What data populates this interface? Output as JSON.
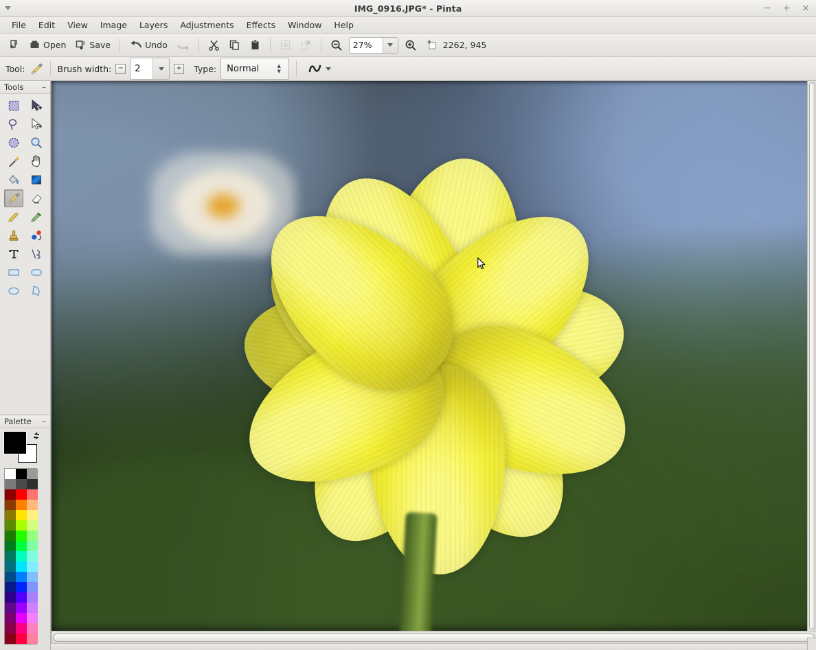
{
  "window": {
    "title": "IMG_0916.JPG* - Pinta",
    "menu_arrow_icon": "chevron-down-icon",
    "controls": [
      {
        "name": "minimize",
        "glyph": "−"
      },
      {
        "name": "maximize",
        "glyph": "+"
      },
      {
        "name": "close",
        "glyph": "×"
      }
    ]
  },
  "menubar": {
    "items": [
      {
        "label": "File"
      },
      {
        "label": "Edit"
      },
      {
        "label": "View"
      },
      {
        "label": "Image"
      },
      {
        "label": "Layers"
      },
      {
        "label": "Adjustments"
      },
      {
        "label": "Effects"
      },
      {
        "label": "Window"
      },
      {
        "label": "Help"
      }
    ]
  },
  "toolbar": {
    "new_label": "",
    "open_label": "Open",
    "save_label": "Save",
    "undo_label": "Undo",
    "redo_label": "",
    "cut_label": "",
    "copy_label": "",
    "paste_label": "",
    "crop_label": "",
    "deselect_label": "",
    "zoom_out_label": "",
    "zoom_in_label": "",
    "zoom_value": "27%",
    "zoom_dropdown_icon": "chevron-down-icon",
    "cursor_position": "2262, 945",
    "icons": {
      "new": "new-image-icon",
      "open": "open-folder-icon",
      "save": "save-disk-icon",
      "undo": "undo-arrow-icon",
      "redo": "redo-arrow-icon",
      "cut": "scissors-icon",
      "copy": "copy-icon",
      "paste": "clipboard-icon",
      "crop": "crop-to-selection-icon",
      "deselect": "deselect-icon",
      "zoom_out": "zoom-out-icon",
      "zoom_in": "zoom-in-icon",
      "position": "cursor-position-icon"
    }
  },
  "tooloptions": {
    "tool_label": "Tool:",
    "tool_icon": "paintbrush-icon",
    "brush_width_label": "Brush width:",
    "brush_width_value": "2",
    "decrease_glyph": "−",
    "increase_glyph": "+",
    "dropdown_icon": "chevron-down-icon",
    "type_label": "Type:",
    "type_value": "Normal",
    "blend_icon": "squiggle-curve-icon",
    "blend_dropdown_icon": "chevron-down-icon"
  },
  "tools_panel": {
    "title": "Tools",
    "minimize_glyph": "–",
    "selected_tool": "paintbrush",
    "tools": [
      {
        "id": "rectangle-select",
        "label": "Rectangle Select"
      },
      {
        "id": "move-selected",
        "label": "Move Selected"
      },
      {
        "id": "lasso-select",
        "label": "Lasso Select"
      },
      {
        "id": "move-selection",
        "label": "Move Selection"
      },
      {
        "id": "ellipse-select",
        "label": "Ellipse Select"
      },
      {
        "id": "zoom",
        "label": "Zoom"
      },
      {
        "id": "magic-wand",
        "label": "Magic Wand Select"
      },
      {
        "id": "pan",
        "label": "Pan"
      },
      {
        "id": "paint-bucket",
        "label": "Paint Bucket"
      },
      {
        "id": "gradient",
        "label": "Gradient"
      },
      {
        "id": "paintbrush",
        "label": "Paintbrush"
      },
      {
        "id": "eraser",
        "label": "Eraser"
      },
      {
        "id": "pencil",
        "label": "Pencil"
      },
      {
        "id": "color-picker",
        "label": "Color Picker"
      },
      {
        "id": "clone-stamp",
        "label": "Clone Stamp"
      },
      {
        "id": "recolor",
        "label": "Recolor"
      },
      {
        "id": "text",
        "label": "Text"
      },
      {
        "id": "line-curve",
        "label": "Line / Curve"
      },
      {
        "id": "rectangle",
        "label": "Rectangle"
      },
      {
        "id": "rounded-rectangle",
        "label": "Rounded Rectangle"
      },
      {
        "id": "ellipse",
        "label": "Ellipse"
      },
      {
        "id": "freeform-shape",
        "label": "Freeform Shape"
      }
    ]
  },
  "palette_panel": {
    "title": "Palette",
    "minimize_glyph": "–",
    "primary_color": "#000000",
    "secondary_color": "#ffffff",
    "swap_icon": "swap-colors-icon",
    "swatches": [
      [
        "#ffffff",
        "#000000",
        "#9a9a9a"
      ],
      [
        "#7b7b7b",
        "#4a4a4a",
        "#303030"
      ],
      [
        "#8a0000",
        "#ff0000",
        "#ff7272"
      ],
      [
        "#8a3a00",
        "#ff7f00",
        "#ffb87a"
      ],
      [
        "#8a7a00",
        "#ffe500",
        "#fff07f"
      ],
      [
        "#5c8a00",
        "#a8ff00",
        "#d3ff7f"
      ],
      [
        "#1f7a00",
        "#22ff00",
        "#95ff7f"
      ],
      [
        "#007a1f",
        "#00ff40",
        "#7fffa3"
      ],
      [
        "#007a5e",
        "#00ffbf",
        "#7fffdf"
      ],
      [
        "#00707f",
        "#00e5ff",
        "#7fefff"
      ],
      [
        "#004c8a",
        "#0080ff",
        "#7fbfff"
      ],
      [
        "#0b1a8a",
        "#0026ff",
        "#8093ff"
      ],
      [
        "#2e008a",
        "#5500ff",
        "#aa7fff"
      ],
      [
        "#5e0a8a",
        "#9d00ff",
        "#ce7fff"
      ],
      [
        "#7a0070",
        "#e800ff",
        "#f47fff"
      ],
      [
        "#8a0048",
        "#ff0080",
        "#ff7fbf"
      ],
      [
        "#8a0018",
        "#ff0040",
        "#ff7f9f"
      ]
    ]
  },
  "canvas": {
    "image_name": "IMG_0916.JPG",
    "subject": "yellow dahlia flower close-up",
    "cursor_icon": "arrow-pointer-cursor"
  },
  "scrollbars": {
    "horizontal_name": "canvas-horizontal-scrollbar",
    "vertical_name": "canvas-vertical-scrollbar"
  }
}
